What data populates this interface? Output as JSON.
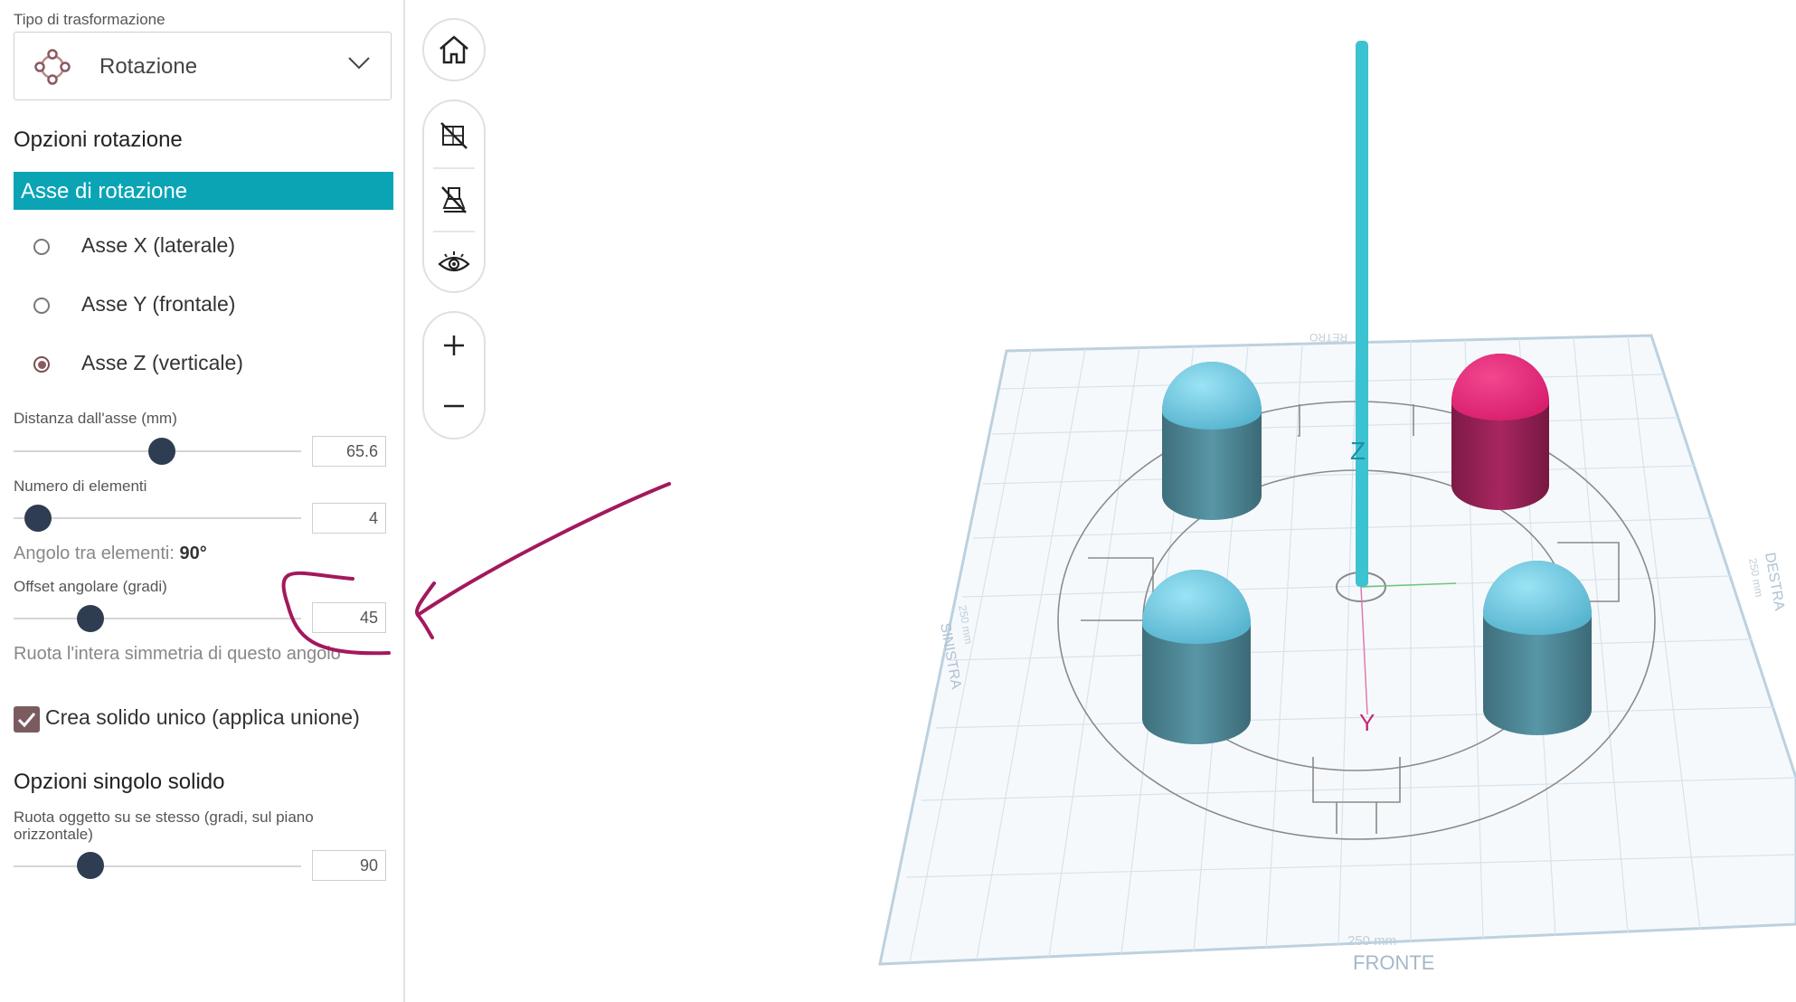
{
  "transform": {
    "type_label": "Tipo di trasformazione",
    "selected": "Rotazione",
    "icon": "rotation-icon"
  },
  "rotation_options": {
    "title": "Opzioni rotazione",
    "axis_header": "Asse di rotazione",
    "axes": [
      {
        "label": "Asse X (laterale)",
        "checked": false
      },
      {
        "label": "Asse Y (frontale)",
        "checked": false
      },
      {
        "label": "Asse Z (verticale)",
        "checked": true
      }
    ],
    "distance": {
      "label": "Distanza dall'asse (mm)",
      "value": "65.6"
    },
    "count": {
      "label": "Numero di elementi",
      "value": "4"
    },
    "angle_between_label": "Angolo tra elementi:",
    "angle_between_value": "90°",
    "offset": {
      "label": "Offset angolare (gradi)",
      "value": "45",
      "hint": "Ruota l'intera simmetria di questo angolo"
    },
    "union": {
      "label": "Crea solido unico (applica unione)",
      "checked": true
    }
  },
  "single_solid": {
    "title": "Opzioni singolo solido",
    "rotate_label": "Ruota oggetto su se stesso (gradi, sul piano orizzontale)",
    "value": "90"
  },
  "toolbar": {
    "icons": [
      "home-icon",
      "hide-grid-icon",
      "hide-plate-icon",
      "eye-icon",
      "zoom-in-icon",
      "zoom-out-icon"
    ]
  },
  "viewport": {
    "axis_z": "Z",
    "axis_y": "Y",
    "plate_front": "FRONTE",
    "plate_left": "SINISTRA",
    "plate_right": "DESTRA",
    "plate_back": "RETRO",
    "plate_size": "250 mm",
    "plate_size_side": "250 mm"
  },
  "colors": {
    "accent": "#0aa4b5",
    "cylinder": "#4e8897",
    "cylinder_top": "#7fd3ea",
    "selected_cylinder": "#a0245a",
    "selected_top": "#e8307f",
    "annotation": "#a3185e"
  }
}
